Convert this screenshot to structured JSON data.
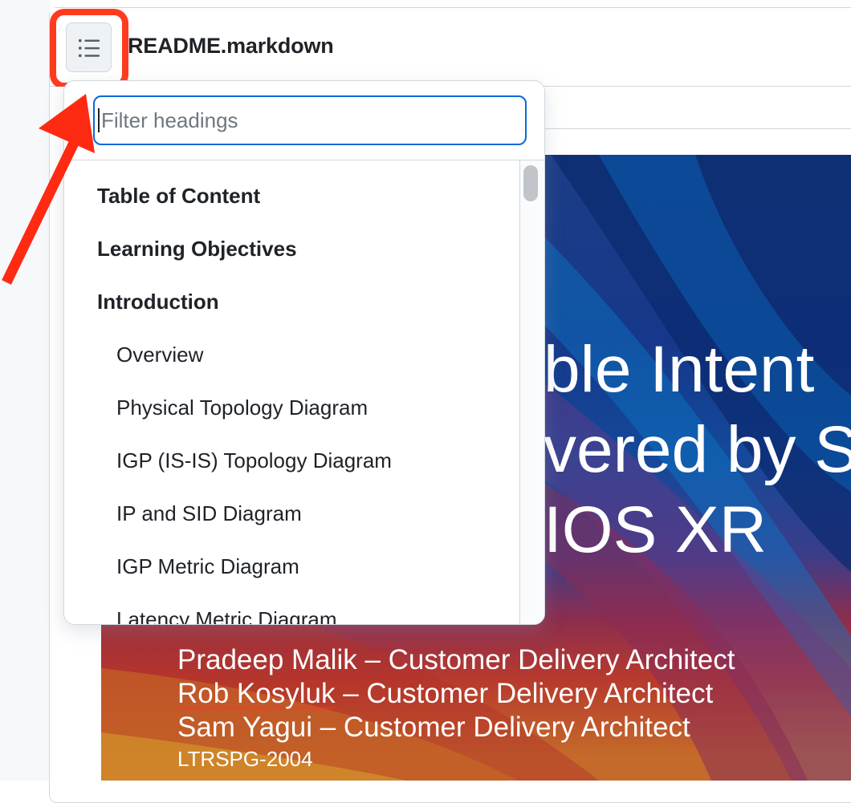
{
  "file": {
    "title": "README.markdown",
    "toc_icon": "list-unordered-icon"
  },
  "slide": {
    "title_lines": [
      "Scalable Intent",
      "Powered by S",
      "IOS XR"
    ],
    "title_visible": "ble Intent\nvered by S\nIOS XR",
    "presenters": [
      {
        "name": "Pradeep Malik",
        "sep": " – ",
        "role": "Customer Delivery Architect"
      },
      {
        "name": "Rob Kosyluk",
        "sep": " – ",
        "role": "Customer Delivery Architect"
      },
      {
        "name": "Sam Yagui",
        "sep": " – ",
        "role": "Customer Delivery Architect"
      }
    ],
    "session_code": "LTRSPG-2004"
  },
  "toc": {
    "filter_placeholder": "Filter headings",
    "filter_value": "",
    "items": [
      {
        "label": "Table of Content",
        "level": 1
      },
      {
        "label": "Learning Objectives",
        "level": 1
      },
      {
        "label": "Introduction",
        "level": 1
      },
      {
        "label": "Overview",
        "level": 2
      },
      {
        "label": "Physical Topology Diagram",
        "level": 2
      },
      {
        "label": "IGP (IS-IS) Topology Diagram",
        "level": 2
      },
      {
        "label": "IP and SID Diagram",
        "level": 2
      },
      {
        "label": "IGP Metric Diagram",
        "level": 2
      },
      {
        "label": "Latency Metric Diagram",
        "level": 2
      }
    ]
  },
  "annotation": {
    "highlight_color": "#ff3b1f",
    "arrow_color": "#ff2a12"
  },
  "colors": {
    "accent": "#0969da",
    "border": "#d0d7de"
  }
}
